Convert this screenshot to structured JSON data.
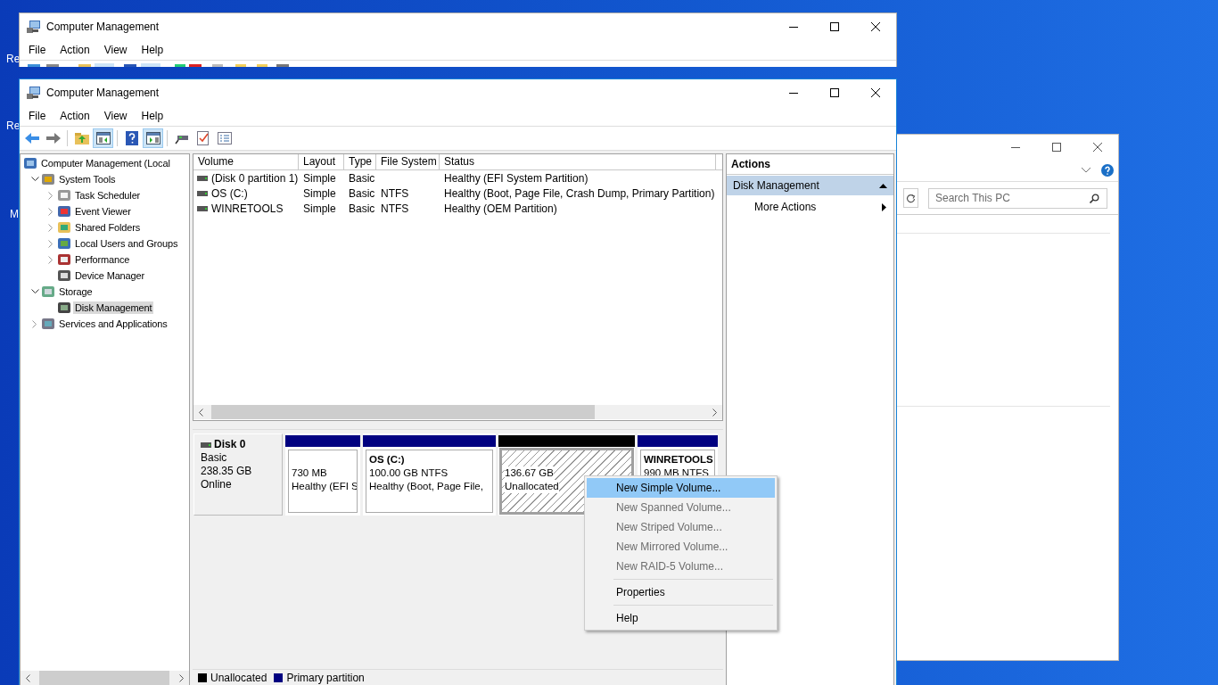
{
  "desktop_icons": [
    {
      "label": "Re"
    },
    {
      "label": "Re"
    },
    {
      "label": "M"
    }
  ],
  "back_window": {
    "title": "Computer Management",
    "menu": [
      "File",
      "Action",
      "View",
      "Help"
    ]
  },
  "explorer_window": {
    "search": {
      "placeholder": "Search This PC"
    }
  },
  "window": {
    "title": "Computer Management",
    "menu": [
      "File",
      "Action",
      "View",
      "Help"
    ],
    "toolbar": [
      {
        "pressed": false
      },
      {
        "pressed": false
      },
      {
        "pressed": false
      },
      {
        "pressed": true
      },
      {
        "pressed": false
      },
      {
        "pressed": true
      },
      {
        "pressed": false
      },
      {
        "pressed": false
      },
      {
        "pressed": false
      }
    ],
    "tree": [
      {
        "label": "Computer Management (Local",
        "selected": false,
        "children": [
          {
            "label": "System Tools",
            "expanded": true,
            "selected": false,
            "children": [
              {
                "label": "Task Scheduler",
                "expanded": false,
                "selected": false
              },
              {
                "label": "Event Viewer",
                "expanded": false,
                "selected": false
              },
              {
                "label": "Shared Folders",
                "expanded": false,
                "selected": false
              },
              {
                "label": "Local Users and Groups",
                "expanded": false,
                "selected": false
              },
              {
                "label": "Performance",
                "expanded": false,
                "selected": false
              },
              {
                "label": "Device Manager",
                "selected": false
              }
            ]
          },
          {
            "label": "Storage",
            "expanded": true,
            "selected": false,
            "children": [
              {
                "label": "Disk Management",
                "selected": true
              }
            ]
          },
          {
            "label": "Services and Applications",
            "expanded": false,
            "selected": false
          }
        ]
      }
    ],
    "volume_table": {
      "columns": [
        "Volume",
        "Layout",
        "Type",
        "File System",
        "Status"
      ],
      "rows": [
        {
          "volume": "(Disk 0 partition 1)",
          "layout": "Simple",
          "type": "Basic",
          "status": "Healthy (EFI System Partition)"
        },
        {
          "volume": "OS (C:)",
          "layout": "Simple",
          "type": "Basic",
          "file_system": "NTFS",
          "status": "Healthy (Boot, Page File, Crash Dump, Primary Partition)"
        },
        {
          "volume": "WINRETOOLS",
          "layout": "Simple",
          "type": "Basic",
          "file_system": "NTFS",
          "status": "Healthy (OEM Partition)"
        }
      ]
    },
    "disk": {
      "name": "Disk 0",
      "type": "Basic",
      "size": "238.35 GB",
      "status": "Online",
      "partitions": [
        {
          "kind": "primary",
          "color": "#000080",
          "selected": false,
          "size": "730 MB",
          "status": "Healthy (EFI S"
        },
        {
          "kind": "primary",
          "color": "#000080",
          "selected": false,
          "title": "OS  (C:)",
          "size": "100.00 GB NTFS",
          "status": "Healthy (Boot, Page File,"
        },
        {
          "kind": "unallocated",
          "color": "#000000",
          "selected": true,
          "size": "136.67 GB",
          "status": "Unallocated"
        },
        {
          "kind": "primary",
          "color": "#000080",
          "selected": false,
          "title": "WINRETOOLS",
          "size": "990 MB NTFS"
        }
      ]
    },
    "legend": [
      {
        "label": "Unallocated",
        "color": "#000000"
      },
      {
        "label": "Primary partition",
        "color": "#000080"
      }
    ],
    "actions": {
      "title": "Actions",
      "section": {
        "label": "Disk Management",
        "expanded": true
      },
      "items": [
        {
          "label": "More Actions"
        }
      ]
    }
  },
  "context_menu": {
    "groups": [
      [
        {
          "label": "New Simple Volume...",
          "disabled": false,
          "selected": true
        },
        {
          "label": "New Spanned Volume...",
          "disabled": true,
          "selected": false
        },
        {
          "label": "New Striped Volume...",
          "disabled": true,
          "selected": false
        },
        {
          "label": "New Mirrored Volume...",
          "disabled": true,
          "selected": false
        },
        {
          "label": "New RAID-5 Volume...",
          "disabled": true,
          "selected": false
        }
      ],
      [
        {
          "label": "Properties",
          "disabled": false,
          "selected": false
        }
      ],
      [
        {
          "label": "Help",
          "disabled": false,
          "selected": false
        }
      ]
    ]
  }
}
